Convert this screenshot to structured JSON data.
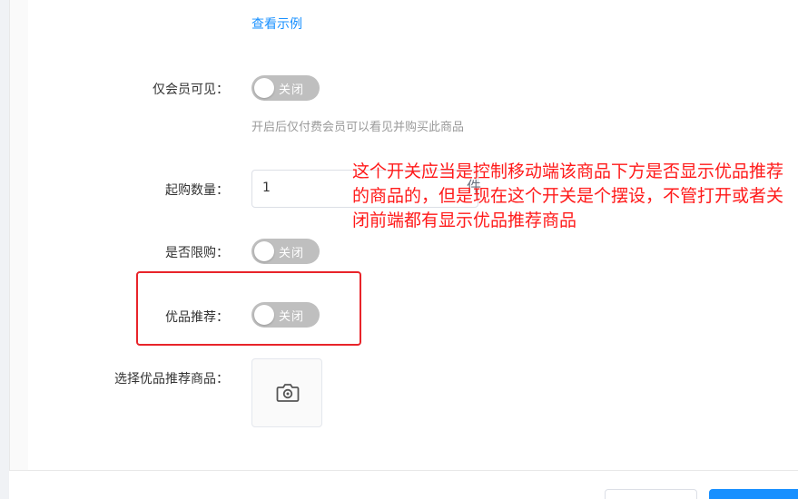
{
  "link": {
    "view_example": "查看示例"
  },
  "members_only": {
    "label": "仅会员可见：",
    "switch_text": "关闭",
    "help": "开启后仅付费会员可以看见并购买此商品"
  },
  "min_purchase": {
    "label": "起购数量：",
    "value": "1",
    "unit": "件"
  },
  "purchase_limit": {
    "label": "是否限购：",
    "switch_text": "关闭"
  },
  "recommend": {
    "label": "优品推荐：",
    "switch_text": "关闭"
  },
  "recommend_goods": {
    "label": "选择优品推荐商品：",
    "upload_icon": "camera-icon"
  },
  "annotation": {
    "text": "这个开关应当是控制移动端该商品下方是否显示优品推荐的商品的，但是现在这个开关是个摆设，不管打开或者关闭前端都有显示优品推荐商品"
  },
  "colors": {
    "link": "#1890ff",
    "switch_off": "#bfbfbf",
    "annotation": "#ff1a1a",
    "primary": "#1890ff"
  }
}
